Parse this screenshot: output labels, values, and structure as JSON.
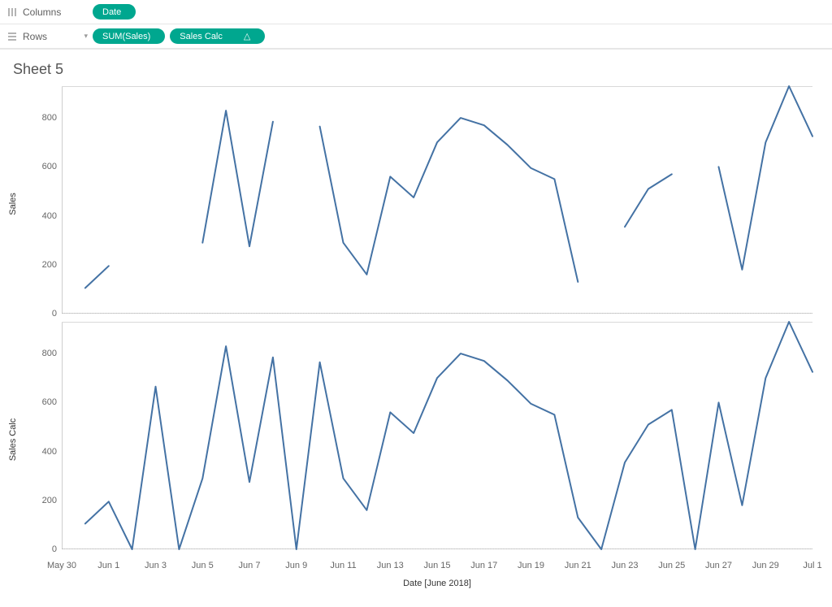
{
  "shelves": {
    "columns_label": "Columns",
    "rows_label": "Rows",
    "pills": {
      "date": "Date",
      "sum_sales": "SUM(Sales)",
      "sales_calc": "Sales Calc"
    }
  },
  "sheet": {
    "title": "Sheet 5"
  },
  "axes": {
    "y1_label": "Sales",
    "y2_label": "Sales Calc",
    "x_label": "Date [June 2018]",
    "y_ticks": [
      0,
      200,
      400,
      600,
      800
    ],
    "x_ticks": [
      "May 30",
      "Jun 1",
      "Jun 3",
      "Jun 5",
      "Jun 7",
      "Jun 9",
      "Jun 11",
      "Jun 13",
      "Jun 15",
      "Jun 17",
      "Jun 19",
      "Jun 21",
      "Jun 23",
      "Jun 25",
      "Jun 27",
      "Jun 29",
      "Jul 1"
    ],
    "y_range": [
      0,
      930
    ],
    "x_range_index": [
      0,
      32
    ]
  },
  "chart_data": {
    "type": "line",
    "ylim": [
      0,
      930
    ],
    "dates": [
      "May 30",
      "May 31",
      "Jun 1",
      "Jun 2",
      "Jun 3",
      "Jun 4",
      "Jun 5",
      "Jun 6",
      "Jun 7",
      "Jun 8",
      "Jun 9",
      "Jun 10",
      "Jun 11",
      "Jun 12",
      "Jun 13",
      "Jun 14",
      "Jun 15",
      "Jun 16",
      "Jun 17",
      "Jun 18",
      "Jun 19",
      "Jun 20",
      "Jun 21",
      "Jun 22",
      "Jun 23",
      "Jun 24",
      "Jun 25",
      "Jun 26",
      "Jun 27",
      "Jun 28",
      "Jun 29",
      "Jun 30",
      "Jul 1"
    ],
    "series": [
      {
        "name": "Sales",
        "values": [
          null,
          105,
          195,
          null,
          665,
          null,
          290,
          830,
          275,
          785,
          null,
          765,
          290,
          160,
          560,
          475,
          700,
          800,
          770,
          690,
          595,
          550,
          130,
          null,
          355,
          510,
          570,
          null,
          600,
          180,
          700,
          930,
          725
        ]
      },
      {
        "name": "Sales Calc",
        "values": [
          null,
          105,
          195,
          0,
          665,
          0,
          290,
          830,
          275,
          785,
          0,
          765,
          290,
          160,
          560,
          475,
          700,
          800,
          770,
          690,
          595,
          550,
          130,
          0,
          355,
          510,
          570,
          0,
          600,
          180,
          700,
          930,
          725
        ]
      }
    ],
    "title": "Sheet 5",
    "xlabel": "Date [June 2018]",
    "ylabel_top": "Sales",
    "ylabel_bottom": "Sales Calc"
  }
}
